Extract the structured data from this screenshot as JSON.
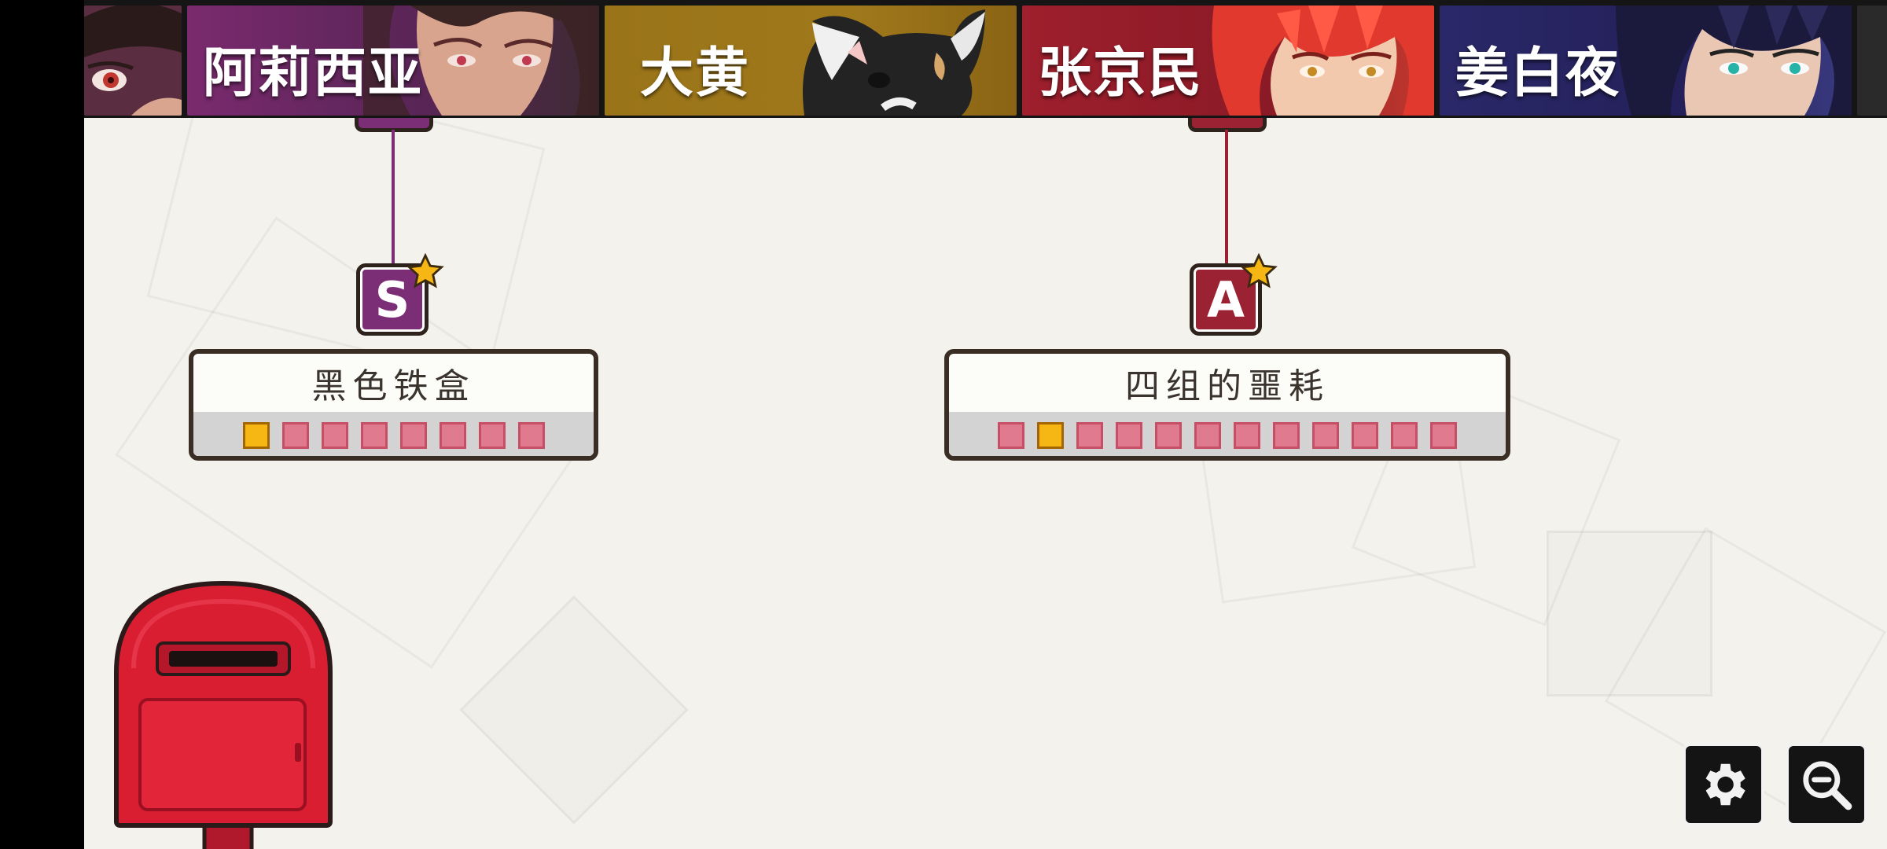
{
  "tabs": [
    {
      "name": "",
      "color": "#6b3a58"
    },
    {
      "name": "阿莉西亚",
      "color": "#7a2a6e"
    },
    {
      "name": "大黄",
      "color": "#9a7418"
    },
    {
      "name": "张京民",
      "color": "#9e1f2d"
    },
    {
      "name": "姜白夜",
      "color": "#2a2868"
    }
  ],
  "nodes": [
    {
      "grade": "S",
      "color": "#7b2d76",
      "title": "黑色铁盒",
      "progress": {
        "completed": [
          1
        ],
        "total": 8
      }
    },
    {
      "grade": "A",
      "color": "#9a2232",
      "title": "四组的噩耗",
      "progress": {
        "completed": [
          2
        ],
        "total": 12
      }
    }
  ],
  "controls": {
    "settings_icon": "gear-icon",
    "zoom_icon": "zoom-out-icon"
  },
  "accent": {
    "star": "#f6b614",
    "slot_empty": "#e07a8e"
  }
}
